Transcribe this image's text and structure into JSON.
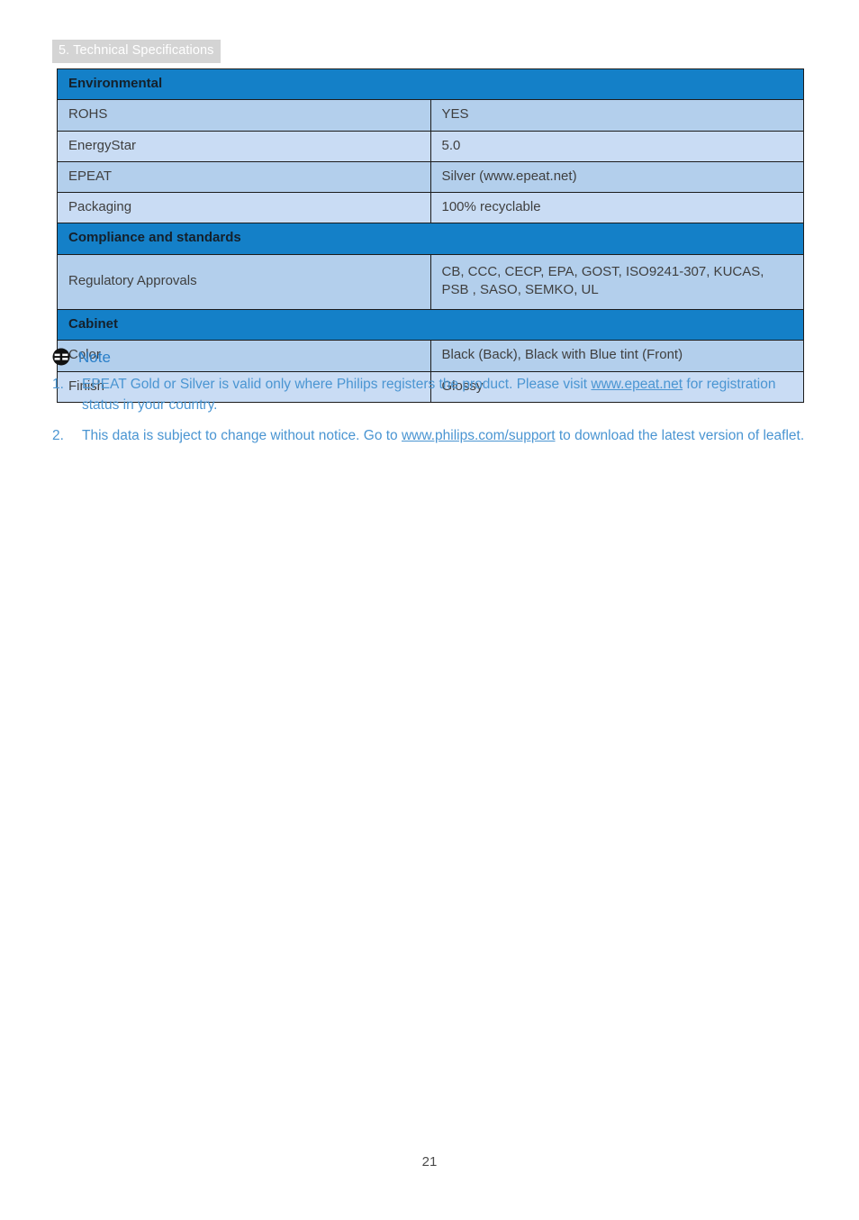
{
  "document": {
    "section_header": "5. Technical Specifications",
    "page_number": "21"
  },
  "spec_table": {
    "sections": [
      {
        "title": "Environmental",
        "rows": [
          {
            "label": "ROHS",
            "value": "YES"
          },
          {
            "label": "EnergyStar",
            "value": "5.0"
          },
          {
            "label": "EPEAT",
            "value": "Silver (www.epeat.net)"
          },
          {
            "label": "Packaging",
            "value": "100% recyclable"
          }
        ]
      },
      {
        "title": "Compliance and standards",
        "rows": [
          {
            "label": "Regulatory Approvals",
            "value": "CB, CCC, CECP, EPA, GOST, ISO9241-307,  KUCAS, PSB , SASO, SEMKO, UL"
          }
        ]
      },
      {
        "title": "Cabinet",
        "rows": [
          {
            "label": "Color",
            "value": "Black (Back), Black with Blue tint (Front)"
          },
          {
            "label": "Finish",
            "value": "Glossy"
          }
        ]
      }
    ]
  },
  "note": {
    "icon": "note-icon",
    "title": "Note",
    "items": [
      {
        "number": "1.",
        "text_before": "EPEAT Gold or Silver is valid only where Philips registers the product. Please visit ",
        "link": "www.epeat.net",
        "text_after": " for registration status in your country."
      },
      {
        "number": "2.",
        "text_before": "This data is subject to change without notice. Go to ",
        "link": "www.philips.com/support",
        "text_after": " to download the latest version of leaflet."
      }
    ]
  },
  "colors": {
    "section_header_bg": "#d4d4d4",
    "table_section_bg": "#1480c8",
    "row_shade_dark": "#b3cfec",
    "row_shade_light": "#c9dcf4",
    "note_text": "#4a95d2",
    "note_title": "#2a7fc9",
    "border": "#1c1c1c"
  }
}
